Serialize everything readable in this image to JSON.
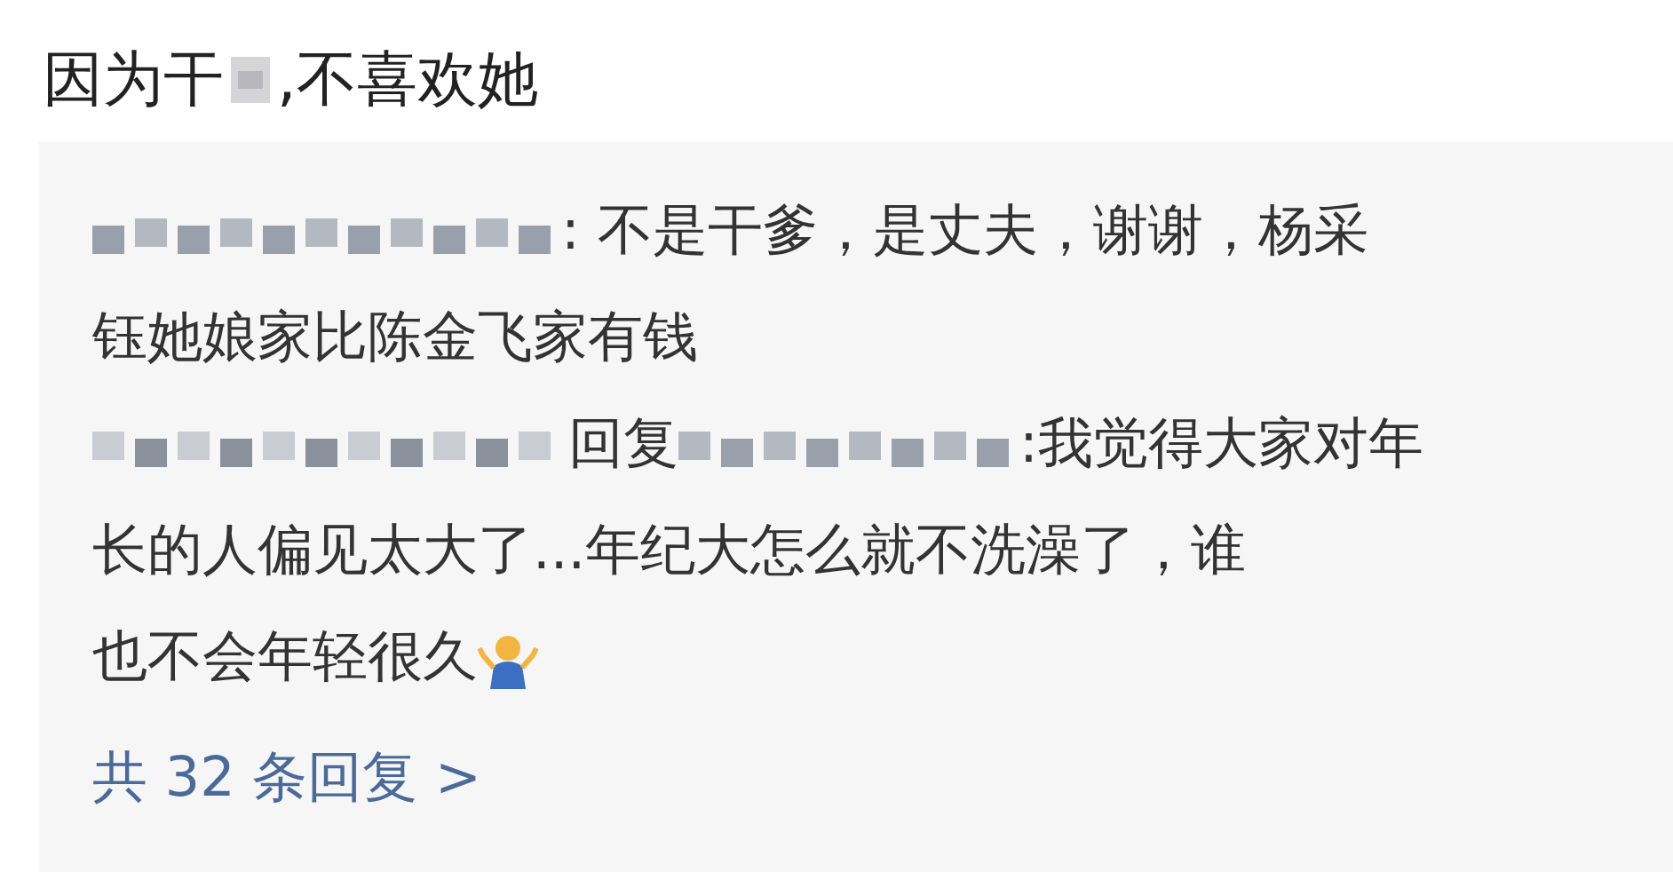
{
  "post": {
    "title_start": "因为干",
    "title_end": ",不喜欢她"
  },
  "replies": [
    {
      "lines": [
        ": 不是干爹，是丈夫，谢谢，杨采",
        "钰她娘家比陈金飞家有钱"
      ]
    },
    {
      "reply_word": "回复",
      "lines": [
        ":我觉得大家对年",
        "长的人偏见太大了...年纪大怎么就不洗澡了，谁",
        "也不会年轻很久"
      ],
      "emoji": true
    }
  ],
  "more_replies": "共 32 条回复 >"
}
